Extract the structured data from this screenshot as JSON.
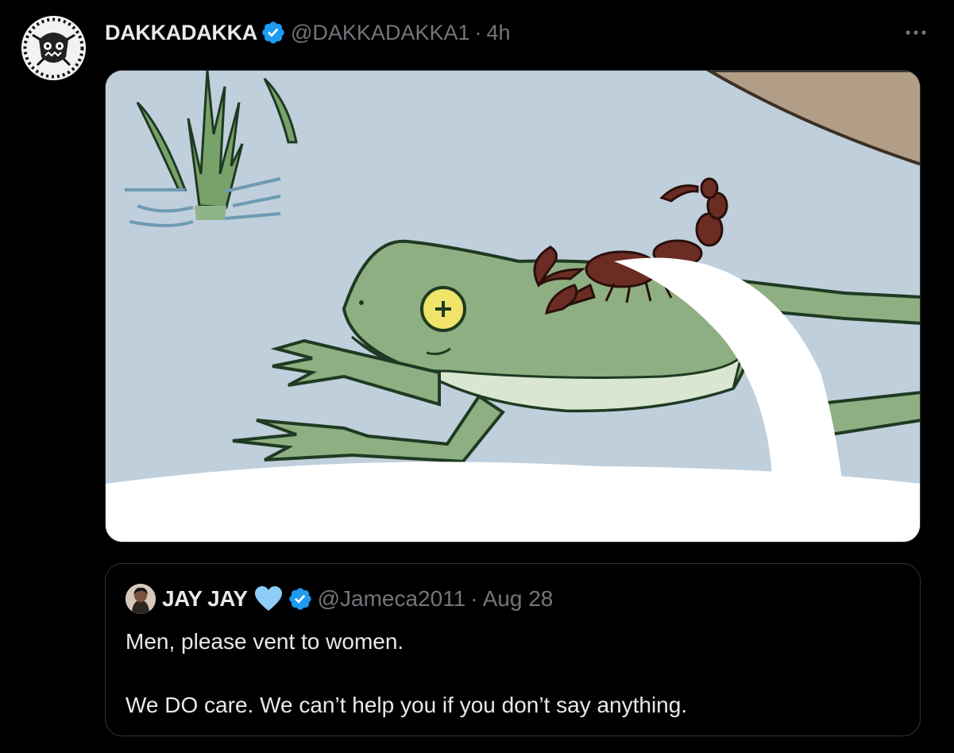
{
  "tweet": {
    "author_name": "DAKKADAKKA",
    "author_handle": "@DAKKADAKKA1",
    "separator": "·",
    "time": "4h",
    "verified_icon": "verified-badge-icon",
    "more_icon": "more-options-icon",
    "more_label": "···",
    "media_description_icon": "frog-and-scorpion-cartoon"
  },
  "quote": {
    "author_name": "JAY JAY",
    "author_handle": "@Jameca2011",
    "separator": "·",
    "date": "Aug 28",
    "heart_icon": "blue-heart-icon",
    "verified_icon": "verified-badge-icon",
    "line1": "Men, please vent to women.",
    "line2": "We DO care. We can’t help you if you don’t say anything."
  },
  "colors": {
    "background": "#000000",
    "text_primary": "#e7e9ea",
    "text_secondary": "#71767b",
    "verified_blue": "#1d9bf0",
    "heart_blue": "#8ecdf7",
    "border": "#2f3336"
  }
}
